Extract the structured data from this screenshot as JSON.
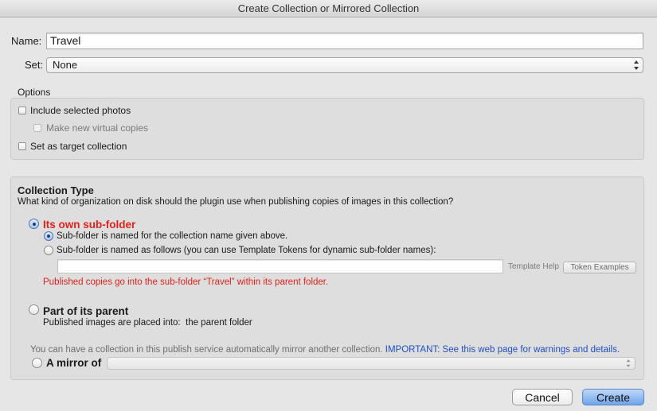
{
  "window": {
    "title": "Create Collection or Mirrored Collection"
  },
  "form": {
    "name_label": "Name:",
    "name_value": "Travel",
    "set_label": "Set:",
    "set_value": "None"
  },
  "options": {
    "heading": "Options",
    "include_selected": "Include selected photos",
    "make_virtual_copies": "Make new virtual copies",
    "set_as_target": "Set as target collection"
  },
  "collection_type": {
    "heading": "Collection Type",
    "question": "What kind of organization on disk should the plugin use when publishing copies of images in this collection?",
    "own_subfolder": {
      "label": "Its own sub-folder",
      "named_for_collection": "Sub-folder is named for the collection name given above.",
      "named_as_follows": "Sub-folder is named as follows (you can use Template Tokens for dynamic sub-folder names):",
      "template_value": "",
      "template_help": "Template Help",
      "token_examples": "Token Examples",
      "published_note": "Published copies go into the sub-folder “Travel” within its parent folder."
    },
    "part_of_parent": {
      "label": "Part of its parent",
      "placed_into_label": "Published images are placed into:",
      "placed_into_value": "the parent folder"
    },
    "mirror": {
      "info": "You can have a collection in this publish service automatically mirror another collection.",
      "important_link": "IMPORTANT: See this web page for warnings and details.",
      "label": "A mirror of",
      "value": ""
    }
  },
  "buttons": {
    "cancel": "Cancel",
    "create": "Create"
  },
  "colors": {
    "accent": "#5b86c5",
    "warning_red": "#e0221b",
    "link_blue": "#1f4fc9"
  }
}
